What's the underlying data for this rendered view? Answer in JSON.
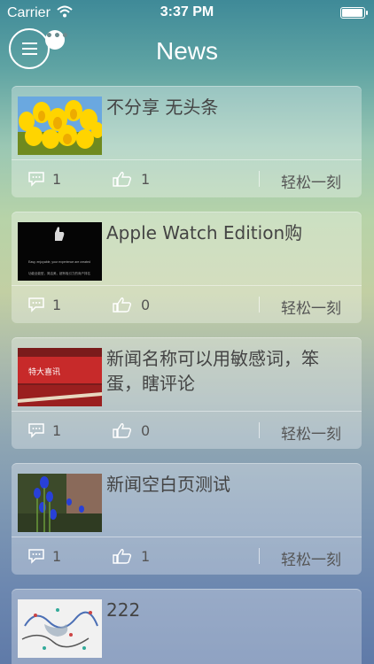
{
  "status": {
    "carrier": "Carrier",
    "time": "3:37 PM"
  },
  "nav": {
    "title": "News",
    "badge": "•••"
  },
  "items": [
    {
      "title": "不分享 无头条",
      "comments": "1",
      "likes": "1",
      "source": "轻松一刻"
    },
    {
      "title": "Apple Watch Edition购",
      "comments": "1",
      "likes": "0",
      "source": "轻松一刻"
    },
    {
      "title": "新闻名称可以用敏感词，笨蛋，瞎评论",
      "comments": "1",
      "likes": "0",
      "source": "轻松一刻"
    },
    {
      "title": "新闻空白页测试",
      "comments": "1",
      "likes": "1",
      "source": "轻松一刻"
    },
    {
      "title": "222",
      "comments": "",
      "likes": "",
      "source": ""
    }
  ],
  "thumb_images": [
    "yellow-tulips",
    "apple-watch-black",
    "red-banner",
    "blue-flowers",
    "abstract-print"
  ],
  "thumb_texts": {
    "watch_line1": "Easy, enjoyable, your experience are created",
    "watch_line2": "功能全能型，简洁美，超有吸引力的商户排名",
    "banner": "特大喜讯"
  }
}
